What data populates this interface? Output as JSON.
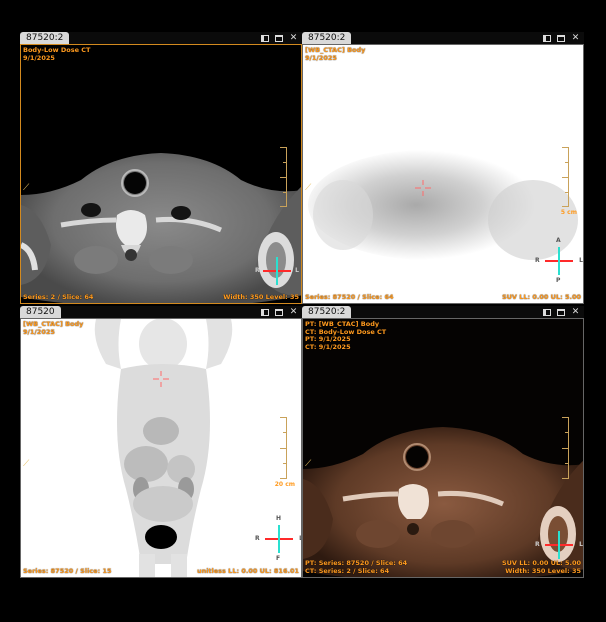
{
  "viewports": [
    {
      "tab": "87520:2",
      "top_left": [
        "Body-Low Dose CT",
        "9/1/2025"
      ],
      "bottom_left": "Series: 2 / Slice: 64",
      "bottom_right": [
        "Width: 350 Level: 35"
      ],
      "scale_label": ""
    },
    {
      "tab": "87520:2",
      "top_left": [
        "[WB_CTAC] Body",
        "9/1/2025"
      ],
      "bottom_left": "Series: 87520 / Slice: 64",
      "bottom_right": [
        "SUV LL: 0.00 UL: 5.00"
      ],
      "scale_label": "5 cm"
    },
    {
      "tab": "87520",
      "top_left": [
        "[WB_CTAC] Body",
        "9/1/2025"
      ],
      "bottom_left": "Series: 87520 / Slice: 15",
      "bottom_right": [
        "unitless LL: 0.00 UL: 816.01"
      ],
      "scale_label": "20 cm"
    },
    {
      "tab": "87520:2",
      "top_left": [
        "PT: [WB_CTAC] Body",
        "CT: Body-Low Dose CT",
        "PT: 9/1/2025",
        "CT: 9/1/2025"
      ],
      "bottom_left_lines": [
        "PT: Series: 87520 / Slice: 64",
        "CT: Series: 2 / Slice: 64"
      ],
      "bottom_right": [
        "SUV LL: 0.00 UL: 5.00",
        "Width: 350 Level: 35"
      ],
      "scale_label": ""
    }
  ],
  "orientation": {
    "anterior": "A",
    "posterior": "P",
    "right": "R",
    "left": "L",
    "head": "H",
    "foot": "F"
  },
  "colors": {
    "accent": "#ff9a1e",
    "active_border": "#d38a1f",
    "tab_bg": "#d9d9d9"
  }
}
